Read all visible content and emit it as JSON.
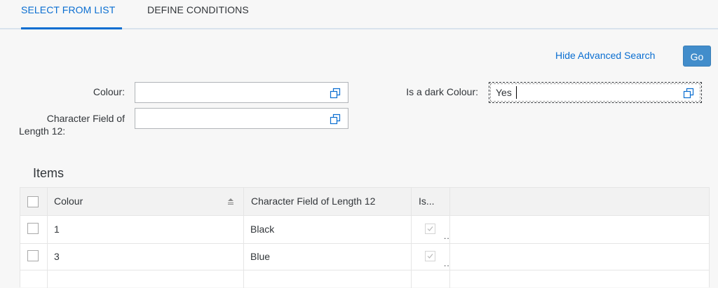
{
  "tabs": [
    {
      "label": "SELECT FROM LIST",
      "selected": true
    },
    {
      "label": "DEFINE CONDITIONS",
      "selected": false
    }
  ],
  "search": {
    "hide_advanced_label": "Hide Advanced Search",
    "go_label": "Go"
  },
  "filters": {
    "colour": {
      "label": "Colour:",
      "value": ""
    },
    "char_field": {
      "label_line1": "Character Field of",
      "label_line2": "Length 12:",
      "value": ""
    },
    "dark_colour": {
      "label": "Is a dark Colour:",
      "value": "Yes"
    }
  },
  "items": {
    "title": "Items",
    "columns": [
      "Colour",
      "Character Field of Length 12",
      "Is..."
    ],
    "rows": [
      {
        "colour": "1",
        "char_field": "Black",
        "is_dark": true,
        "trunc": ".."
      },
      {
        "colour": "3",
        "char_field": "Blue",
        "is_dark": true,
        "trunc": ".."
      }
    ]
  },
  "colors": {
    "accent": "#0a6ed1",
    "button": "#428dcb",
    "background": "#f7f7f7"
  },
  "icons": [
    "value-help-icon",
    "sort-ascending-icon",
    "checkmark-icon"
  ]
}
